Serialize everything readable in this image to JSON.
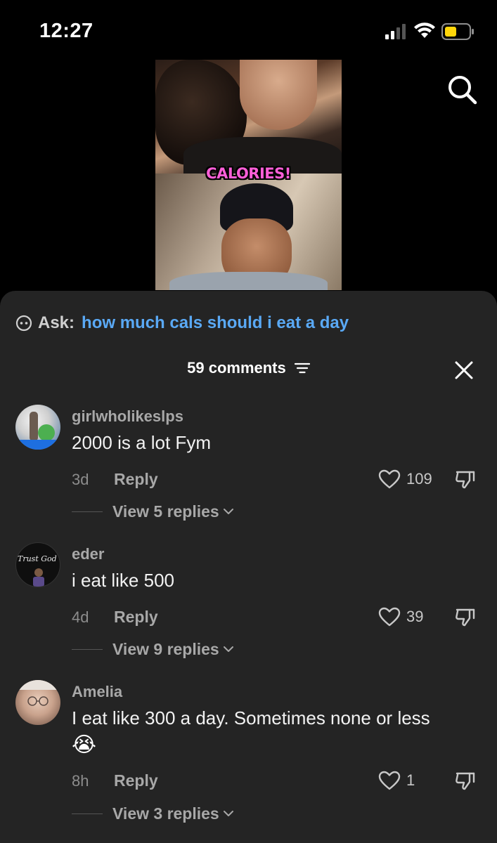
{
  "status_bar": {
    "time": "12:27"
  },
  "video": {
    "caption": "CALORIES!"
  },
  "ask": {
    "label": "Ask:",
    "query": "how much cals should i eat a day"
  },
  "header": {
    "count_label": "59 comments"
  },
  "comments": [
    {
      "username": "girlwholikeslps",
      "text": "2000 is a lot Fym",
      "time": "3d",
      "reply_label": "Reply",
      "likes": "109",
      "view_replies": "View 5 replies"
    },
    {
      "username": "eder",
      "avatar_text": "Trust God",
      "text": "i eat like 500",
      "time": "4d",
      "reply_label": "Reply",
      "likes": "39",
      "view_replies": "View 9 replies"
    },
    {
      "username": "Amelia",
      "text": "I eat like 300 a day. Sometimes none or less",
      "emoji": "😭",
      "time": "8h",
      "reply_label": "Reply",
      "likes": "1",
      "view_replies": "View 3 replies"
    }
  ],
  "colors": {
    "sheet_bg": "#242424",
    "ask_query": "#5aa9f5",
    "caption": "#ff5fd8",
    "battery": "#ffd60a"
  }
}
